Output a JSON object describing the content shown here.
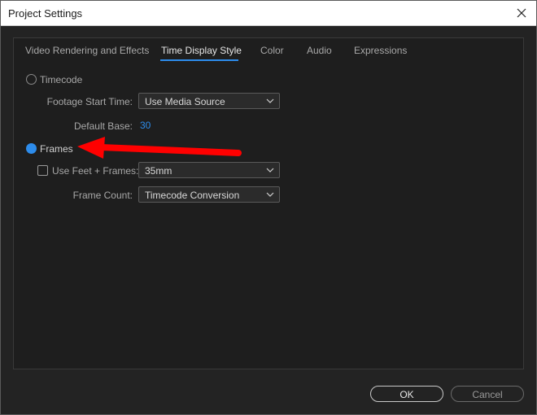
{
  "window": {
    "title": "Project Settings",
    "close_icon": "close-icon"
  },
  "tabs": [
    {
      "label": "Video Rendering and Effects",
      "active": false
    },
    {
      "label": "Time Display Style",
      "active": true
    },
    {
      "label": "Color",
      "active": false
    },
    {
      "label": "Audio",
      "active": false
    },
    {
      "label": "Expressions",
      "active": false
    }
  ],
  "timecode": {
    "label": "Timecode",
    "selected": false,
    "footage_start_time_label": "Footage Start Time:",
    "footage_start_time_value": "Use Media Source",
    "default_base_label": "Default Base:",
    "default_base_value": "30"
  },
  "frames": {
    "label": "Frames",
    "selected": true,
    "use_feet_frames_label": "Use Feet + Frames:",
    "use_feet_frames_checked": false,
    "use_feet_frames_value": "35mm",
    "frame_count_label": "Frame Count:",
    "frame_count_value": "Timecode Conversion"
  },
  "buttons": {
    "ok": "OK",
    "cancel": "Cancel"
  },
  "colors": {
    "accent": "#2d8ceb",
    "annotation_arrow": "#ff0000"
  }
}
